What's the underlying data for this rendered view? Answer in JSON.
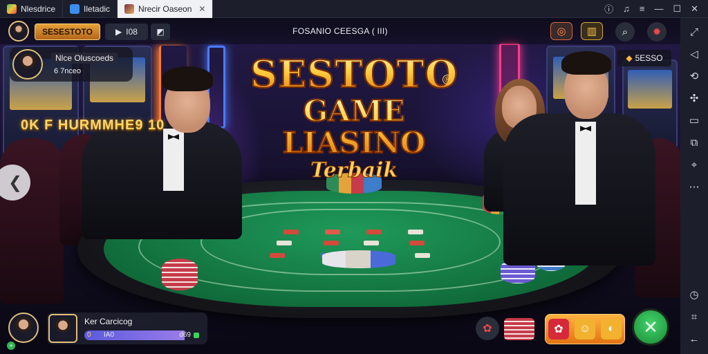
{
  "titlebar": {
    "tabs": [
      {
        "label": "Nlesdrice",
        "active": false
      },
      {
        "label": "Iletadic",
        "active": false
      },
      {
        "label": "Nrecir Oaseon",
        "active": true
      }
    ],
    "controls": [
      "help-icon",
      "bell-icon",
      "minimize-icon",
      "maximize-icon",
      "close-icon"
    ]
  },
  "hud": {
    "brand": "SESESTOTO",
    "count": "I08",
    "title": "FOSANIO CEESGA ( III)",
    "player": {
      "line1": "Nlce Oluscoeds",
      "line2": "6 7nceo"
    },
    "notif": "5ESSO"
  },
  "promo": "0K F HURMMHE9 10",
  "logo": {
    "line1": "SESTOTO",
    "line2": "GAME LIASINO",
    "line3": "Terbaik"
  },
  "me": {
    "name": "Ker Carcicog",
    "left": "0",
    "mid": "IA0",
    "right": "d69",
    "progress": 0.85
  },
  "colors": {
    "accent": "#e5a23a",
    "go": "#2fb552",
    "felt": "#157a44"
  }
}
